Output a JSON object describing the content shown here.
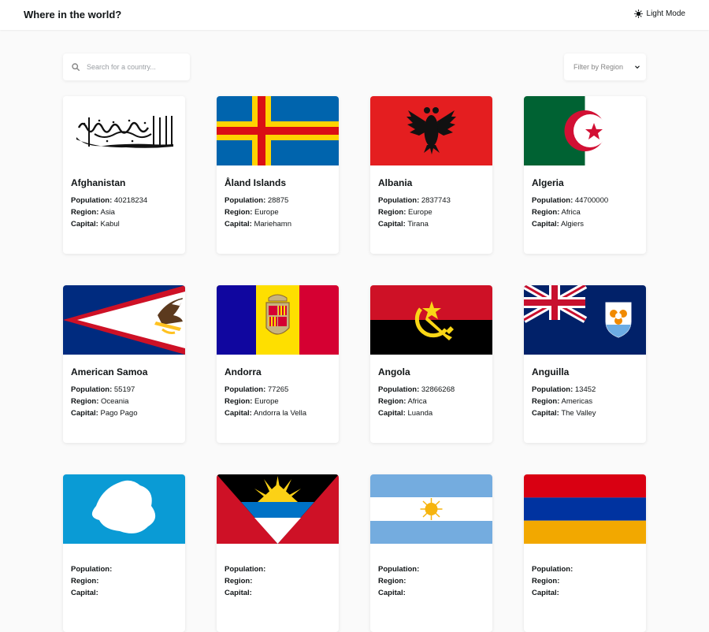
{
  "header": {
    "title": "Where in the world?",
    "mode_label": "Light Mode"
  },
  "search": {
    "placeholder": "Search for a country...",
    "value": ""
  },
  "filter": {
    "selected_label": "Filter by Region"
  },
  "labels": {
    "population": "Population:",
    "region": "Region:",
    "capital": "Capital:"
  },
  "countries": [
    {
      "name": "Afghanistan",
      "population": "40218234",
      "region": "Asia",
      "capital": "Kabul"
    },
    {
      "name": "Åland Islands",
      "population": "28875",
      "region": "Europe",
      "capital": "Mariehamn"
    },
    {
      "name": "Albania",
      "population": "2837743",
      "region": "Europe",
      "capital": "Tirana"
    },
    {
      "name": "Algeria",
      "population": "44700000",
      "region": "Africa",
      "capital": "Algiers"
    },
    {
      "name": "American Samoa",
      "population": "55197",
      "region": "Oceania",
      "capital": "Pago Pago"
    },
    {
      "name": "Andorra",
      "population": "77265",
      "region": "Europe",
      "capital": "Andorra la Vella"
    },
    {
      "name": "Angola",
      "population": "32866268",
      "region": "Africa",
      "capital": "Luanda"
    },
    {
      "name": "Anguilla",
      "population": "13452",
      "region": "Americas",
      "capital": "The Valley"
    },
    {
      "name": "",
      "population": "",
      "region": "",
      "capital": ""
    },
    {
      "name": "",
      "population": "",
      "region": "",
      "capital": ""
    },
    {
      "name": "",
      "population": "",
      "region": "",
      "capital": ""
    },
    {
      "name": "",
      "population": "",
      "region": "",
      "capital": ""
    }
  ],
  "flag_icons": [
    "afghanistan-flag",
    "aland-islands-flag",
    "albania-flag",
    "algeria-flag",
    "american-samoa-flag",
    "andorra-flag",
    "angola-flag",
    "anguilla-flag",
    "antarctica-flag",
    "antigua-and-barbuda-flag",
    "argentina-flag",
    "armenia-flag"
  ],
  "colors": {
    "page_background": "#fafafa",
    "card_background": "#ffffff",
    "text": "#111517"
  }
}
